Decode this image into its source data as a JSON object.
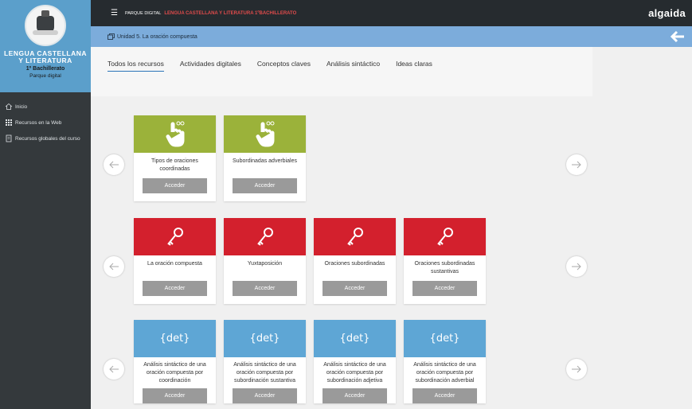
{
  "sidebar": {
    "title": "LENGUA CASTELLANA Y LITERATURA",
    "course": "1º Bachillerato",
    "subtitle": "Parque digital",
    "items": [
      {
        "label": "Inicio",
        "icon": "home-icon"
      },
      {
        "label": "Recursos en la Web",
        "icon": "grid-icon"
      },
      {
        "label": "Recursos globales del curso",
        "icon": "document-icon"
      }
    ]
  },
  "topbar": {
    "crumb_prefix": "PARQUE DIGITAL",
    "crumb_subject": "LENGUA CASTELLANA Y LITERATURA 1ºBACHILLERATO",
    "logo": "algaida"
  },
  "unit": {
    "title": "Unidad 5. La oración compuesta"
  },
  "tabs": [
    "Todos los recursos",
    "Actividades digitales",
    "Conceptos claves",
    "Análisis sintáctico",
    "Ideas claras"
  ],
  "active_tab": "Todos los recursos",
  "colors": {
    "green": "#9bb23a",
    "red": "#d3202d",
    "blue": "#5ea6d5",
    "button": "#9a9a9a"
  },
  "rows": [
    {
      "cards": [
        {
          "title": "Tipos de oraciones coordinadas",
          "button": "Acceder",
          "icon": "pointer-hand-icon"
        },
        {
          "title": "Subordinadas adverbiales",
          "button": "Acceder",
          "icon": "pointer-hand-icon"
        }
      ]
    },
    {
      "cards": [
        {
          "title": "La oración compuesta",
          "button": "Acceder",
          "icon": "key-icon"
        },
        {
          "title": "Yuxtaposición",
          "button": "Acceder",
          "icon": "key-icon"
        },
        {
          "title": "Oraciones subordinadas",
          "button": "Acceder",
          "icon": "key-icon"
        },
        {
          "title": "Oraciones subordinadas sustantivas",
          "button": "Acceder",
          "icon": "key-icon"
        }
      ]
    },
    {
      "cards": [
        {
          "title": "Análisis sintáctico de una oración compuesta por coordinación",
          "button": "Acceder",
          "icon_text": "{det}"
        },
        {
          "title": "Análisis sintáctico de una oración compuesta por subordinación sustantiva",
          "button": "Acceder",
          "icon_text": "{det}"
        },
        {
          "title": "Análisis sintáctico de una oración compuesta por subordinación adjetiva",
          "button": "Acceder",
          "icon_text": "{det}"
        },
        {
          "title": "Análisis sintáctico de una oración compuesta por subordinación adverbial",
          "button": "Acceder",
          "icon_text": "{det}"
        }
      ]
    }
  ]
}
